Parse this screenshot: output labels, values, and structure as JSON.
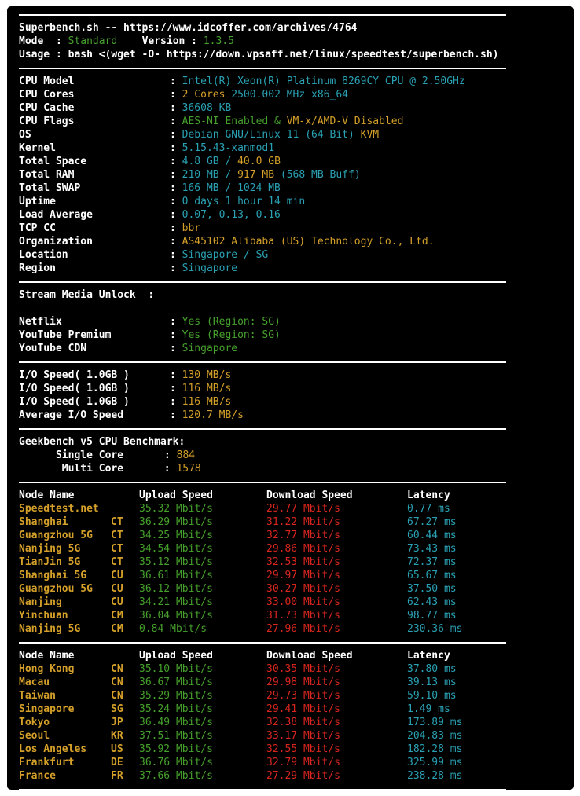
{
  "header": {
    "title_line": "Superbench.sh -- https://www.idcoffer.com/archives/4764",
    "mode_label": "Mode  : ",
    "mode_value": "Standard",
    "version_label": "Version : ",
    "version_value": "1.3.5",
    "usage_line": "Usage : bash <(wget -O- https://down.vpsaff.net/linux/speedtest/superbench.sh)"
  },
  "sysinfo": {
    "cpu_model": {
      "label": "CPU Model",
      "value": "Intel(R) Xeon(R) Platinum 8269CY CPU @ 2.50GHz"
    },
    "cpu_cores": {
      "label": "CPU Cores",
      "value_a": "2 Cores",
      "value_b": "2500.002 MHz x86_64"
    },
    "cpu_cache": {
      "label": "CPU Cache",
      "value": "36608 KB"
    },
    "cpu_flags": {
      "label": "CPU Flags",
      "value_a": "AES-NI Enabled &",
      "value_b": "VM-x/AMD-V Disabled"
    },
    "os": {
      "label": "OS",
      "value_a": "Debian GNU/Linux 11 (64 Bit)",
      "value_b": "KVM"
    },
    "kernel": {
      "label": "Kernel",
      "value": "5.15.43-xanmod1"
    },
    "total_space": {
      "label": "Total Space",
      "used": "4.8 GB",
      "slash": " / ",
      "total": "40.0 GB"
    },
    "total_ram": {
      "label": "Total RAM",
      "used": "210 MB",
      "slash": " / ",
      "total": "917 MB",
      "buff": "(568 MB Buff)"
    },
    "total_swap": {
      "label": "Total SWAP",
      "value": "166 MB / 1024 MB"
    },
    "uptime": {
      "label": "Uptime",
      "value": "0 days 1 hour 14 min"
    },
    "load_average": {
      "label": "Load Average",
      "value": "0.07, 0.13, 0.16"
    },
    "tcp_cc": {
      "label": "TCP CC",
      "value": "bbr"
    },
    "organization": {
      "label": "Organization",
      "value": "AS45102 Alibaba (US) Technology Co., Ltd."
    },
    "location": {
      "label": "Location",
      "value": "Singapore / SG"
    },
    "region": {
      "label": "Region",
      "value": "Singapore"
    }
  },
  "stream": {
    "title": "Stream Media Unlock  :",
    "netflix": {
      "label": "Netflix",
      "value": "Yes (Region: SG)"
    },
    "youtube_premium": {
      "label": "YouTube Premium",
      "value": "Yes (Region: SG)"
    },
    "youtube_cdn": {
      "label": "YouTube CDN",
      "value": "Singapore"
    }
  },
  "io": {
    "run1": {
      "label": "I/O Speed( 1.0GB )",
      "value": "130 MB/s"
    },
    "run2": {
      "label": "I/O Speed( 1.0GB )",
      "value": "116 MB/s"
    },
    "run3": {
      "label": "I/O Speed( 1.0GB )",
      "value": "116 MB/s"
    },
    "avg": {
      "label": "Average I/O Speed",
      "value": "120.7 MB/s"
    }
  },
  "geekbench": {
    "title": "Geekbench v5 CPU Benchmark:",
    "single": {
      "label": "Single Core",
      "value": "884"
    },
    "multi": {
      "label": "Multi Core",
      "value": "1578"
    }
  },
  "speed_table_headers": {
    "node": "Node Name",
    "upload": "Upload Speed",
    "download": "Download Speed",
    "latency": "Latency"
  },
  "speed_cn": [
    {
      "node": "Speedtest.net",
      "isp": "",
      "upload": "35.32 Mbit/s",
      "download": "29.77 Mbit/s",
      "latency": "0.77 ms"
    },
    {
      "node": "Shanghai",
      "isp": "CT",
      "upload": "36.29 Mbit/s",
      "download": "31.22 Mbit/s",
      "latency": "67.27 ms"
    },
    {
      "node": "Guangzhou 5G",
      "isp": "CT",
      "upload": "34.25 Mbit/s",
      "download": "32.77 Mbit/s",
      "latency": "60.44 ms"
    },
    {
      "node": "Nanjing 5G",
      "isp": "CT",
      "upload": "34.54 Mbit/s",
      "download": "29.86 Mbit/s",
      "latency": "73.43 ms"
    },
    {
      "node": "TianJin 5G",
      "isp": "CT",
      "upload": "35.12 Mbit/s",
      "download": "32.53 Mbit/s",
      "latency": "72.37 ms"
    },
    {
      "node": "Shanghai 5G",
      "isp": "CU",
      "upload": "36.61 Mbit/s",
      "download": "29.97 Mbit/s",
      "latency": "65.67 ms"
    },
    {
      "node": "Guangzhou 5G",
      "isp": "CU",
      "upload": "36.12 Mbit/s",
      "download": "30.27 Mbit/s",
      "latency": "37.50 ms"
    },
    {
      "node": "Nanjing",
      "isp": "CU",
      "upload": "34.21 Mbit/s",
      "download": "33.00 Mbit/s",
      "latency": "62.43 ms"
    },
    {
      "node": "Yinchuan",
      "isp": "CM",
      "upload": "36.04 Mbit/s",
      "download": "31.73 Mbit/s",
      "latency": "98.77 ms"
    },
    {
      "node": "Nanjing 5G",
      "isp": "CM",
      "upload": "0.84 Mbit/s",
      "download": "27.96 Mbit/s",
      "latency": "230.36 ms"
    }
  ],
  "speed_global": [
    {
      "node": "Hong Kong",
      "isp": "CN",
      "upload": "35.10 Mbit/s",
      "download": "30.35 Mbit/s",
      "latency": "37.80 ms"
    },
    {
      "node": "Macau",
      "isp": "CN",
      "upload": "36.67 Mbit/s",
      "download": "29.98 Mbit/s",
      "latency": "39.13 ms"
    },
    {
      "node": "Taiwan",
      "isp": "CN",
      "upload": "35.29 Mbit/s",
      "download": "29.73 Mbit/s",
      "latency": "59.10 ms"
    },
    {
      "node": "Singapore",
      "isp": "SG",
      "upload": "35.24 Mbit/s",
      "download": "29.41 Mbit/s",
      "latency": "1.49 ms"
    },
    {
      "node": "Tokyo",
      "isp": "JP",
      "upload": "36.49 Mbit/s",
      "download": "32.38 Mbit/s",
      "latency": "173.89 ms"
    },
    {
      "node": "Seoul",
      "isp": "KR",
      "upload": "37.51 Mbit/s",
      "download": "33.17 Mbit/s",
      "latency": "204.83 ms"
    },
    {
      "node": "Los Angeles",
      "isp": "US",
      "upload": "35.92 Mbit/s",
      "download": "32.55 Mbit/s",
      "latency": "182.28 ms"
    },
    {
      "node": "Frankfurt",
      "isp": "DE",
      "upload": "36.76 Mbit/s",
      "download": "32.79 Mbit/s",
      "latency": "325.99 ms"
    },
    {
      "node": "France",
      "isp": "FR",
      "upload": "37.66 Mbit/s",
      "download": "27.29 Mbit/s",
      "latency": "238.28 ms"
    }
  ],
  "colors": {
    "background": "#000000",
    "text": "#ffffff",
    "green": "#46a02c",
    "yellow": "#d4a02a",
    "cyan": "#2aa1b3",
    "red": "#d8261e"
  }
}
